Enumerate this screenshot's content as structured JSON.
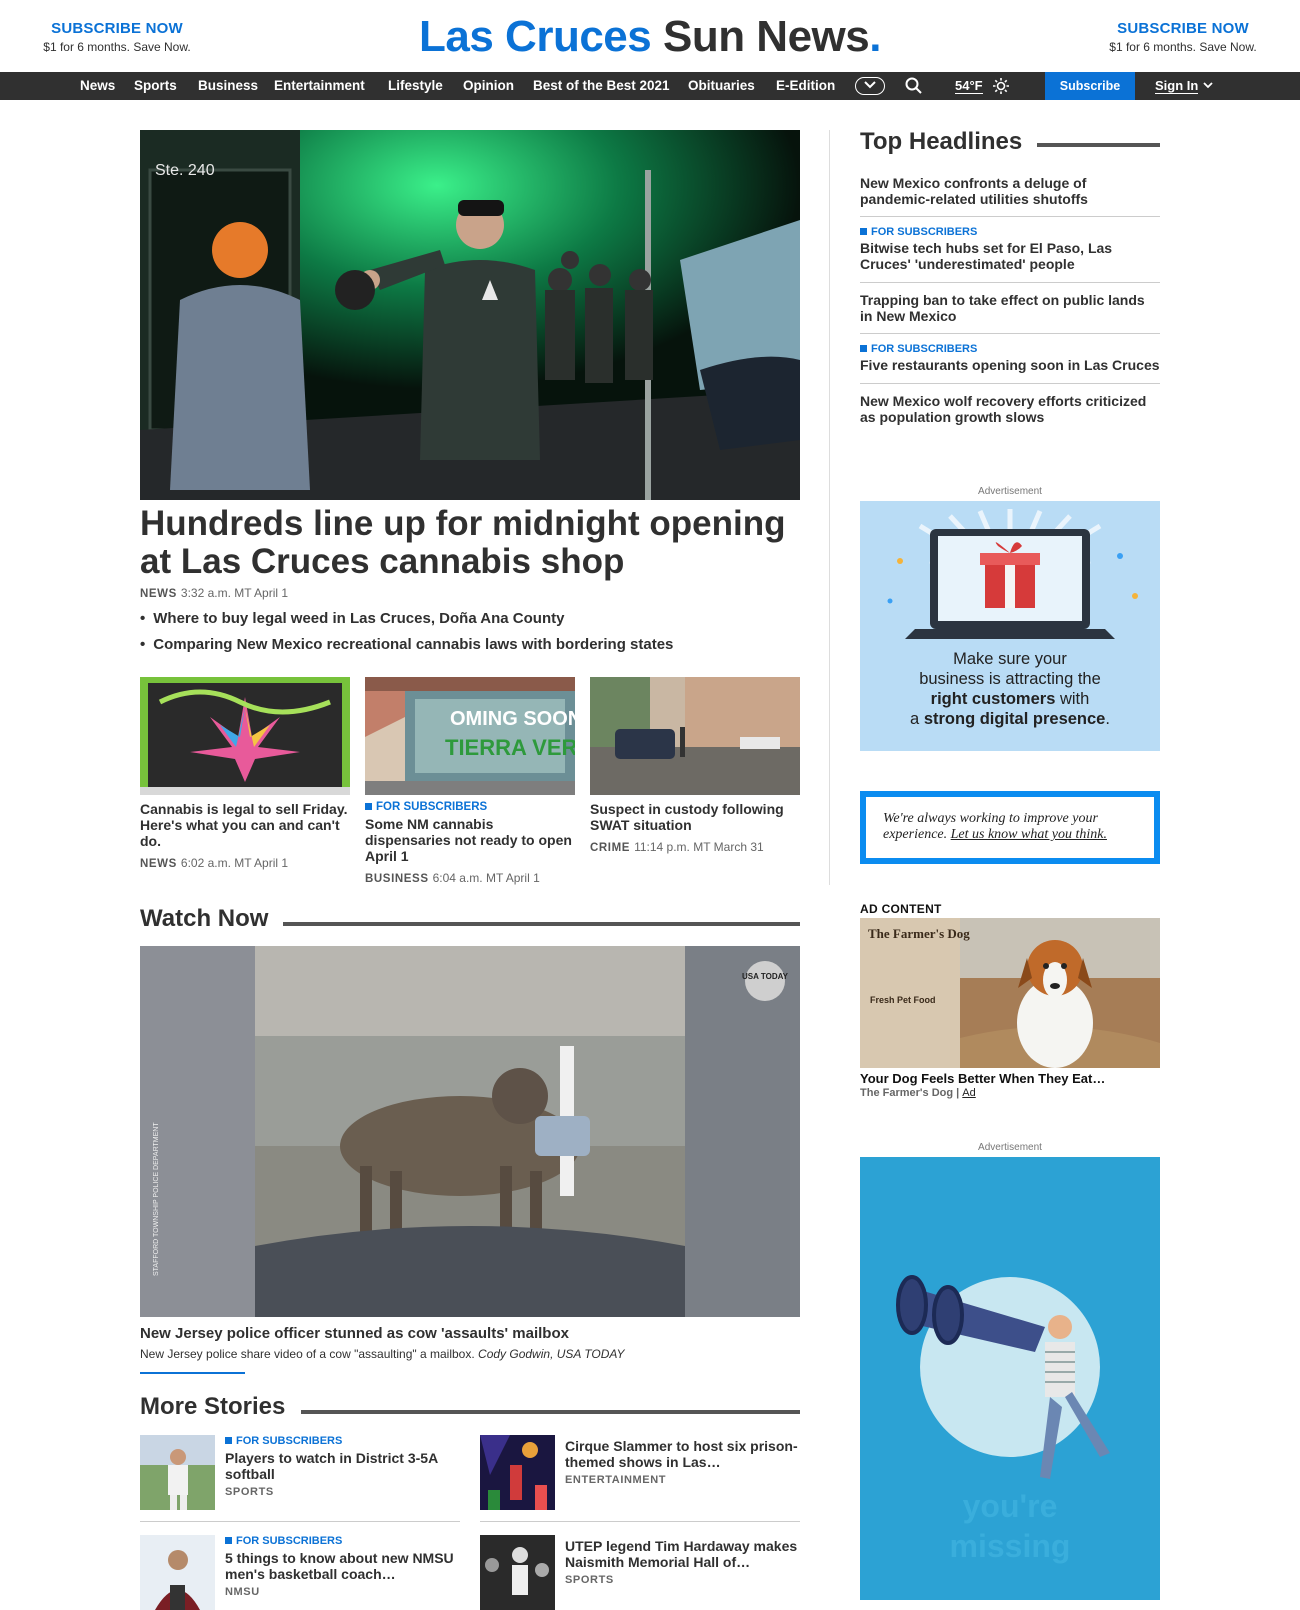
{
  "header": {
    "promo_left": {
      "title": "SUBSCRIBE NOW",
      "subtitle": "$1 for 6 months. Save Now."
    },
    "promo_right": {
      "title": "SUBSCRIBE NOW",
      "subtitle": "$1 for 6 months. Save Now."
    },
    "brand_part1": "Las Cruces",
    "brand_part2": " Sun News",
    "brand_dot": "."
  },
  "nav": {
    "items": [
      "News",
      "Sports",
      "Business",
      "Entertainment",
      "Lifestyle",
      "Opinion",
      "Best of the Best 2021",
      "Obituaries",
      "E-Edition"
    ],
    "weather": "54°F",
    "subscribe": "Subscribe",
    "sign_in": "Sign In"
  },
  "hero": {
    "title": "Hundreds line up for midnight opening at Las Cruces cannabis shop",
    "tag": "NEWS",
    "time": "3:32 a.m. MT April 1",
    "storefront_sign": "Ste. 240",
    "bullets": [
      "Where to buy legal weed in Las Cruces, Doña Ana County",
      "Comparing New Mexico recreational cannabis laws with bordering states"
    ]
  },
  "cards": [
    {
      "subscriber": "",
      "title": "Cannabis is legal to sell Friday. Here's what you can and can't do.",
      "tag": "NEWS",
      "time": "6:02 a.m. MT April 1"
    },
    {
      "subscriber": "FOR SUBSCRIBERS",
      "title": "Some NM cannabis dispensaries not ready to open April 1",
      "tag": "BUSINESS",
      "time": "6:04 a.m. MT April 1"
    },
    {
      "subscriber": "",
      "title": "Suspect in custody following SWAT situation",
      "tag": "CRIME",
      "time": "11:14 p.m. MT March 31"
    }
  ],
  "watch": {
    "heading": "Watch Now",
    "badge": "USA TODAY",
    "watermark": "STAFFORD TOWNSHIP POLICE DEPARTMENT",
    "title": "New Jersey police officer stunned as cow 'assaults' mailbox",
    "caption": "New Jersey police share video of a cow \"assaulting\" a mailbox.",
    "credit": "Cody Godwin, USA TODAY"
  },
  "more": {
    "heading": "More Stories",
    "items": [
      {
        "subscriber": "FOR SUBSCRIBERS",
        "title": "Players to watch in District 3-5A softball",
        "cat": "SPORTS"
      },
      {
        "subscriber": "",
        "title": "Cirque Slammer to host six prison-themed shows in Las…",
        "cat": "ENTERTAINMENT"
      },
      {
        "subscriber": "FOR SUBSCRIBERS",
        "title": "5 things to know about new NMSU men's basketball coach…",
        "cat": "NMSU"
      },
      {
        "subscriber": "",
        "title": "UTEP legend Tim Hardaway makes Naismith Memorial Hall of…",
        "cat": "SPORTS"
      }
    ]
  },
  "top_headlines": {
    "heading": "Top Headlines",
    "items": [
      {
        "subscriber": "",
        "title": "New Mexico confronts a deluge of pandemic-related utilities shutoffs"
      },
      {
        "subscriber": "FOR SUBSCRIBERS",
        "title": "Bitwise tech hubs set for El Paso, Las Cruces' 'underestimated' people"
      },
      {
        "subscriber": "",
        "title": "Trapping ban to take effect on public lands in New Mexico"
      },
      {
        "subscriber": "FOR SUBSCRIBERS",
        "title": "Five restaurants opening soon in Las Cruces"
      },
      {
        "subscriber": "",
        "title": "New Mexico wolf recovery efforts criticized as population growth slows"
      }
    ]
  },
  "ads": {
    "label": "Advertisement",
    "ad1_line1": "Make sure your",
    "ad1_line2": "business is attracting the",
    "ad1_line3a": "right customers",
    "ad1_line3b": " with",
    "ad1_line4a": "a ",
    "ad1_line4b": "strong digital presence",
    "ad1_line4c": ".",
    "feedback_text": "We're always working to improve your experience.",
    "feedback_link": "Let us know what you think.",
    "ad_content_label": "AD CONTENT",
    "ad_content_brand_logo": "The Farmer's Dog",
    "ad_content_pack_text": "Fresh Pet Food",
    "ad_content_title": "Your Dog Feels Better When They Eat…",
    "ad_content_source": "The Farmer's Dog",
    "ad_content_ad": "Ad",
    "ad2_text_line1": "you're",
    "ad2_text_line2": "missing"
  },
  "colors": {
    "accent": "#0b72d6",
    "nav_bg": "#303030",
    "text": "#303030"
  }
}
